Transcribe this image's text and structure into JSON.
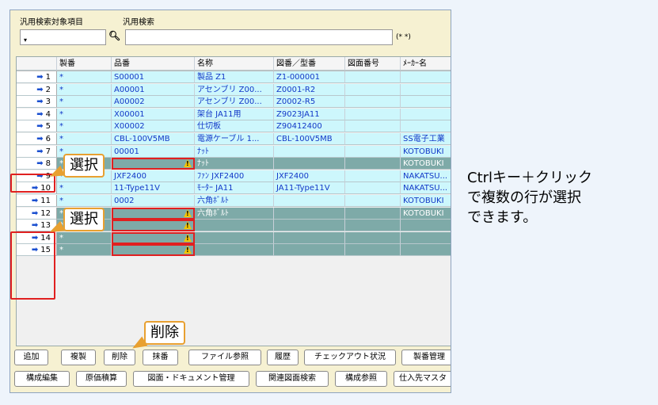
{
  "search": {
    "target_label": "汎用検索対象項目",
    "search_label": "汎用検索",
    "hint": "(* *)"
  },
  "columns": [
    "製番",
    "品番",
    "名称",
    "図番／型番",
    "図面番号",
    "ﾒｰｶｰ名"
  ],
  "rows": [
    {
      "n": "1",
      "style": "cyan",
      "cells": [
        "*",
        "S00001",
        "製品 Z1",
        "Z1-000001",
        "",
        ""
      ],
      "err": false
    },
    {
      "n": "2",
      "style": "cyan",
      "cells": [
        "*",
        "A00001",
        "アセンブリ Z00...",
        "Z0001-R2",
        "",
        ""
      ],
      "err": false
    },
    {
      "n": "3",
      "style": "cyan",
      "cells": [
        "*",
        "A00002",
        "アセンブリ Z00...",
        "Z0002-R5",
        "",
        ""
      ],
      "err": false
    },
    {
      "n": "4",
      "style": "cyan",
      "cells": [
        "*",
        "X00001",
        "架台 JA11用",
        "Z9023JA11",
        "",
        ""
      ],
      "err": false
    },
    {
      "n": "5",
      "style": "cyan",
      "cells": [
        "*",
        "X00002",
        "仕切板",
        "Z90412400",
        "",
        ""
      ],
      "err": false
    },
    {
      "n": "6",
      "style": "cyan",
      "cells": [
        "*",
        "CBL-100V5MB",
        "電源ケーブル 1...",
        "CBL-100V5MB",
        "",
        "SS電子工業"
      ],
      "err": false
    },
    {
      "n": "7",
      "style": "cyan",
      "cells": [
        "*",
        "00001",
        "ﾅｯﾄ",
        "",
        "",
        "KOTOBUKI"
      ],
      "err": false
    },
    {
      "n": "8",
      "style": "teal",
      "cells": [
        "*",
        "",
        "ﾅｯﾄ",
        "",
        "",
        "KOTOBUKI"
      ],
      "err": true
    },
    {
      "n": "9",
      "style": "cyan",
      "cells": [
        "*",
        "JXF2400",
        "ﾌｧﾝ JXF2400",
        "JXF2400",
        "",
        "NAKATSU..."
      ],
      "err": false
    },
    {
      "n": "10",
      "style": "cyan",
      "cells": [
        "*",
        "11-Type11V",
        "ﾓｰﾀｰ JA11",
        "JA11-Type11V",
        "",
        "NAKATSU..."
      ],
      "err": false
    },
    {
      "n": "11",
      "style": "cyan",
      "cells": [
        "*",
        "0002",
        "六角ﾎﾞﾙﾄ",
        "",
        "",
        "KOTOBUKI"
      ],
      "err": false
    },
    {
      "n": "12",
      "style": "teal",
      "cells": [
        "*",
        "",
        "六角ﾎﾞﾙﾄ",
        "",
        "",
        "KOTOBUKI"
      ],
      "err": true
    },
    {
      "n": "13",
      "style": "teal",
      "cells": [
        "*",
        "",
        "",
        "",
        "",
        ""
      ],
      "err": true
    },
    {
      "n": "14",
      "style": "teal",
      "cells": [
        "*",
        "",
        "",
        "",
        "",
        ""
      ],
      "err": true
    },
    {
      "n": "15",
      "style": "teal",
      "cells": [
        "*",
        "",
        "",
        "",
        "",
        ""
      ],
      "err": true
    }
  ],
  "buttons_row1": [
    "追加",
    "複製",
    "削除",
    "抹番",
    "ファイル参照",
    "履歴",
    "チェックアウト状況",
    "製番管理"
  ],
  "buttons_row2": [
    "構成編集",
    "原価積算",
    "図面・ドキュメント管理",
    "関連図面検索",
    "構成参照",
    "仕入先マスタ"
  ],
  "callouts": {
    "select1": "選択",
    "select2": "選択",
    "delete": "削除"
  },
  "note": [
    "Ctrlキー＋クリック",
    "で複数の行が選択",
    "できます。"
  ],
  "colors": {
    "cyan_row": "#cdf7fc",
    "teal_row": "#7eaaa8",
    "callout_border": "#e8a030",
    "highlight": "#e02020"
  }
}
